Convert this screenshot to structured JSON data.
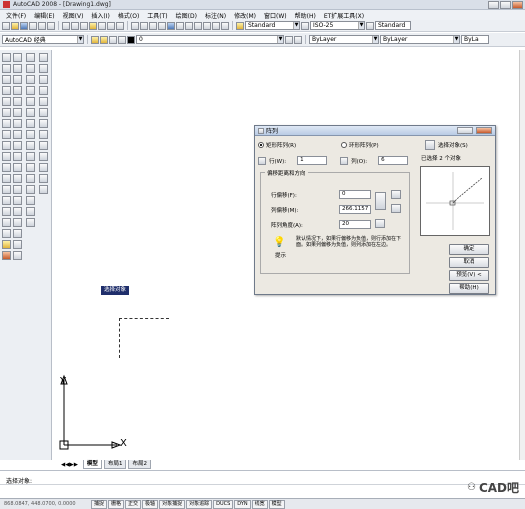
{
  "window": {
    "title": "AutoCAD 2008 - [Drawing1.dwg]"
  },
  "menu": [
    "文件(F)",
    "编辑(E)",
    "视图(V)",
    "插入(I)",
    "格式(O)",
    "工具(T)",
    "绘图(D)",
    "标注(N)",
    "修改(M)",
    "窗口(W)",
    "帮助(H)",
    "ET扩展工具(X)"
  ],
  "toolbar1": {
    "text_style": "Standard",
    "dim_style": "ISO-25",
    "table_style": "Standard"
  },
  "toolbar2": {
    "workspace": "AutoCAD 经典",
    "layer": "0",
    "color": "ByLayer",
    "linetype": "ByLayer",
    "lineweight": "ByLa"
  },
  "canvas": {
    "tooltip": "选择对象",
    "ucs_y": "Y",
    "ucs_x": "X"
  },
  "dialog": {
    "title": "阵列",
    "rect_option": "矩形阵列(R)",
    "polar_option": "环形阵列(P)",
    "select_button": "选择对象(S)",
    "selected_count": "已选择 2 个对象",
    "rows_label": "行(W):",
    "rows_value": "1",
    "cols_label": "列(O):",
    "cols_value": "6",
    "offset_group": "偏移距离和方向",
    "row_offset_label": "行偏移(F):",
    "row_offset_value": "0",
    "col_offset_label": "列偏移(M):",
    "col_offset_value": "266.1157",
    "angle_label": "阵列角度(A):",
    "angle_value": "20",
    "tip_text": "默认情况下，如果行偏移为负值，则行添加在下面。如果列偏移为负值，则列添加在左边。",
    "tip_label": "提示",
    "ok": "确定",
    "cancel": "取消",
    "preview": "预览(V) <",
    "help": "帮助(H)"
  },
  "tabs": [
    "模型",
    "布局1",
    "布局2"
  ],
  "command": {
    "prompt": "选择对象:"
  },
  "status": {
    "coords": "868.0847, 448.0700, 0.0000",
    "toggles": [
      "捕捉",
      "栅格",
      "正交",
      "极轴",
      "对象捕捉",
      "对象追踪",
      "DUCS",
      "DYN",
      "线宽",
      "模型"
    ]
  },
  "watermark": {
    "text": "CAD吧"
  }
}
